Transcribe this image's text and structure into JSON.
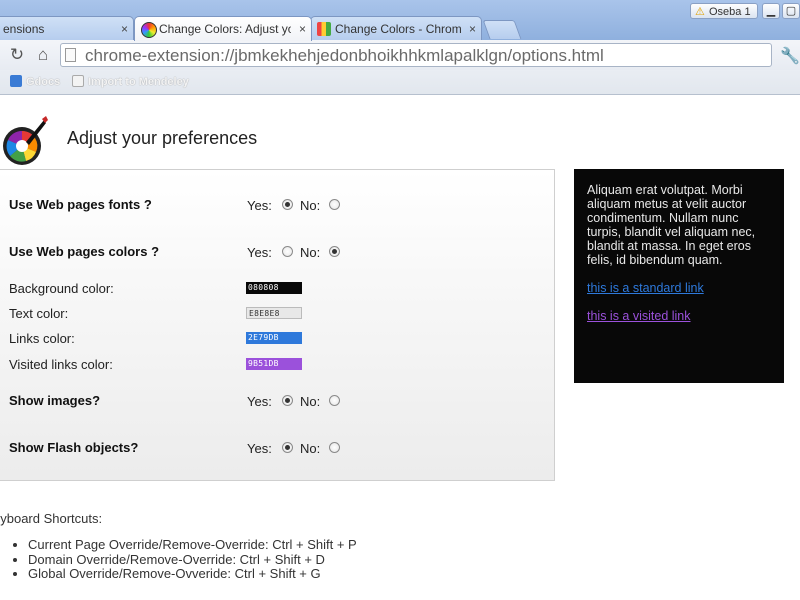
{
  "browser": {
    "tabs": [
      {
        "label": "ensions",
        "active": false
      },
      {
        "label": "Change Colors: Adjust yo",
        "active": true
      },
      {
        "label": "Change Colors - Chrome",
        "active": false
      }
    ],
    "tab_close_glyph": "×",
    "profile_name": "Oseba 1",
    "url": "chrome-extension://jbmkekhehjedonbhoikhhkmlapalklgn/options.html",
    "bookmarks": [
      "Gdocs",
      "Import to Mendeley"
    ]
  },
  "page": {
    "title": "Adjust your preferences",
    "yes_label": "Yes:",
    "no_label": "No:",
    "questions": {
      "fonts": {
        "label": "Use Web pages fonts ?",
        "selected": "yes"
      },
      "colors": {
        "label": "Use Web pages colors ?",
        "selected": "no"
      },
      "images": {
        "label": "Show images?",
        "selected": "yes"
      },
      "flash": {
        "label": "Show Flash objects?",
        "selected": "yes"
      }
    },
    "colors": [
      {
        "label": "Background color:",
        "value": "080808",
        "bg": "#080808",
        "fg": "#ffffff"
      },
      {
        "label": "Text color:",
        "value": "E8E8E8",
        "bg": "#e8e8e8",
        "fg": "#333333"
      },
      {
        "label": "Links color:",
        "value": "2E79DB",
        "bg": "#2e79db",
        "fg": "#ffffff"
      },
      {
        "label": "Visited links color:",
        "value": "9B51DB",
        "bg": "#9b51db",
        "fg": "#ffffff"
      }
    ],
    "preview": {
      "text": "Aliquam erat volutpat. Morbi aliquam metus at velit auctor condimentum. Nullam nunc turpis, blandit vel aliquam nec, blandit at massa. In eget eros felis, id bibendum quam.",
      "standard_link": "this is a standard link",
      "visited_link": "this is a visited link"
    },
    "shortcuts_title": "eyboard Shortcuts:",
    "shortcuts": [
      "Current Page Override/Remove-Override: Ctrl + Shift + P",
      "Domain Override/Remove-Override: Ctrl + Shift + D",
      "Global Override/Remove-Ovveride: Ctrl + Shift + G"
    ]
  }
}
